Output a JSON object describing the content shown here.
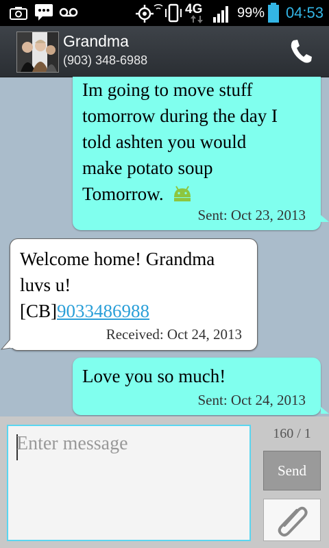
{
  "status_bar": {
    "network": "4G",
    "battery": "99%",
    "time": "04:53",
    "icons": [
      "camera-icon",
      "message-icon",
      "voicemail-icon",
      "gps-icon",
      "vibrate-icon",
      "signal-icon",
      "battery-icon"
    ],
    "accent_color": "#33b5e5"
  },
  "header": {
    "name": "Grandma",
    "number": "(903) 348-6988",
    "call_icon": "phone-icon"
  },
  "messages": [
    {
      "type": "sent",
      "lines": [
        "Im going to move stuff",
        "tomorrow during the day I",
        "told ashten you would",
        "make potato soup",
        "Tomorrow."
      ],
      "emoji": "android-icon",
      "meta": "Sent: Oct 23, 2013"
    },
    {
      "type": "received",
      "lines": [
        "Welcome home! Grandma",
        "luvs u!"
      ],
      "prefix": "[CB]",
      "link": "9033486988",
      "meta": "Received: Oct 24, 2013"
    },
    {
      "type": "sent",
      "lines": [
        "Love you so much!"
      ],
      "meta": "Sent: Oct 24, 2013"
    }
  ],
  "composer": {
    "placeholder": "Enter message",
    "counter": "160 / 1",
    "send_label": "Send",
    "attach_icon": "paperclip-icon"
  },
  "colors": {
    "sent_bubble": "#80ffee",
    "received_bubble": "#ffffff",
    "thread_background": "#aabccb",
    "link": "#2a9fd8"
  }
}
